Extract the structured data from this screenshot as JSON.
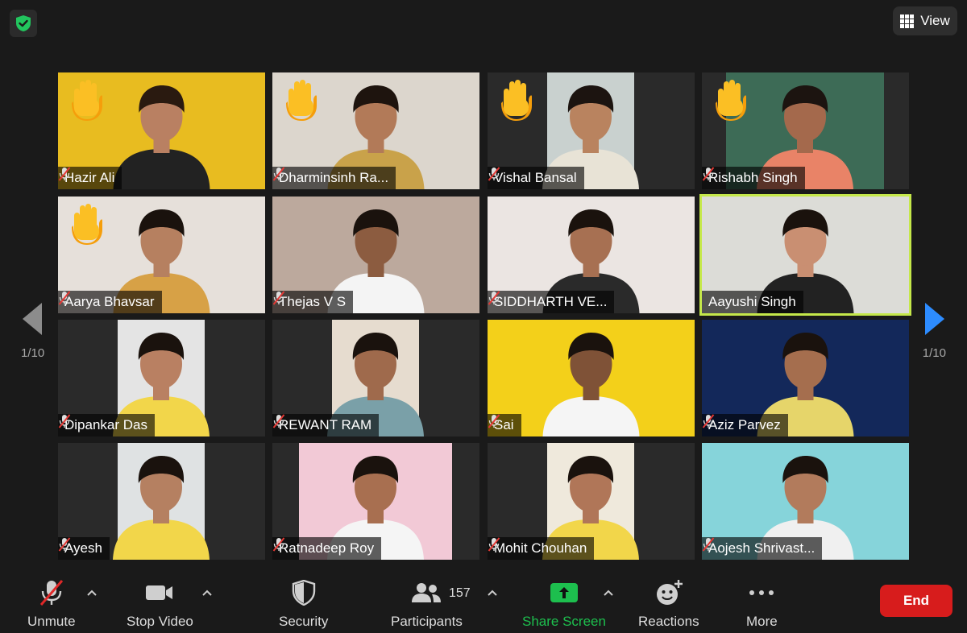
{
  "header": {
    "view_label": "View"
  },
  "pagination": {
    "left": "1/10",
    "right": "1/10"
  },
  "participants_tiles": [
    {
      "name": "Hazir Ali"
    },
    {
      "name": "Dharminsinh Ra..."
    },
    {
      "name": "Vishal Bansal"
    },
    {
      "name": "Rishabh Singh"
    },
    {
      "name": "Aarya Bhavsar"
    },
    {
      "name": "Thejas V S"
    },
    {
      "name": "SIDDHARTH VE..."
    },
    {
      "name": "Aayushi Singh"
    },
    {
      "name": "Dipankar Das"
    },
    {
      "name": "REWANT RAM"
    },
    {
      "name": "Sai"
    },
    {
      "name": "Aziz Parvez"
    },
    {
      "name": "Ayesh"
    },
    {
      "name": "Ratnadeep Roy"
    },
    {
      "name": "Mohit Chouhan"
    },
    {
      "name": "Aojesh Shrivast..."
    }
  ],
  "toolbar": {
    "unmute": "Unmute",
    "stop_video": "Stop Video",
    "security": "Security",
    "participants": "Participants",
    "participant_count": "157",
    "share_screen": "Share Screen",
    "reactions": "Reactions",
    "more": "More",
    "end": "End"
  },
  "colors": {
    "accent_green": "#1dbf4e",
    "end_red": "#d71c1c",
    "active_speaker": "#c5e84a",
    "next_arrow": "#2d8cff"
  }
}
